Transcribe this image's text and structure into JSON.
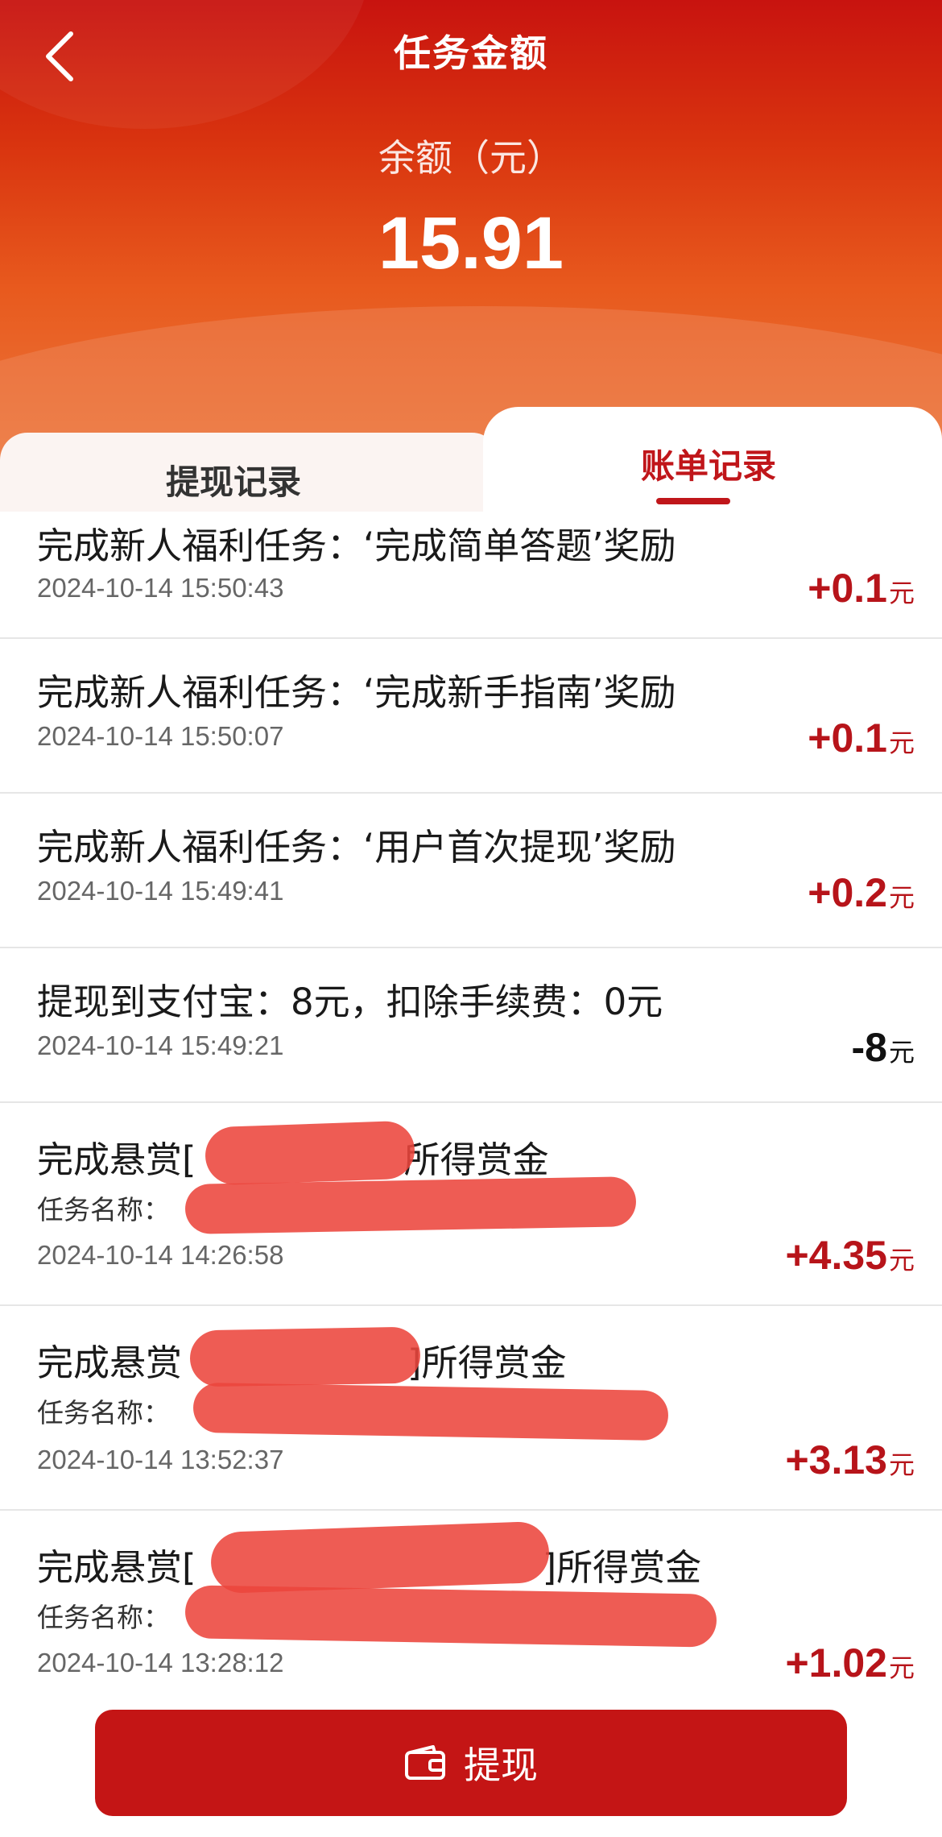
{
  "header": {
    "title": "任务金额",
    "balance_label": "余额（元）",
    "balance_value": "15.91",
    "colors": {
      "primary": "#c41515",
      "accent_text": "#c0161a"
    }
  },
  "tabs": [
    {
      "label": "提现记录",
      "active": false
    },
    {
      "label": "账单记录",
      "active": true
    }
  ],
  "records": [
    {
      "title": "完成新人福利任务：‘完成简单答题’奖励",
      "time": "2024-10-14 15:50:43",
      "amount": "+0.1",
      "unit": "元",
      "color": "#b7141a"
    },
    {
      "title": "完成新人福利任务：‘完成新手指南’奖励",
      "time": "2024-10-14 15:50:07",
      "amount": "+0.1",
      "unit": "元",
      "color": "#b7141a"
    },
    {
      "title": "完成新人福利任务：‘用户首次提现’奖励",
      "time": "2024-10-14 15:49:41",
      "amount": "+0.2",
      "unit": "元",
      "color": "#b7141a"
    },
    {
      "title": "提现到支付宝：8元，扣除手续费：0元",
      "time": "2024-10-14 15:49:21",
      "amount": "-8",
      "unit": "元",
      "color": "#111111"
    },
    {
      "title_prefix": "完成悬赏[",
      "title_suffix": "所得赏金",
      "sub": "任务名称：",
      "time": "2024-10-14 14:26:58",
      "amount": "+4.35",
      "unit": "元",
      "color": "#b7141a"
    },
    {
      "title_prefix": "完成悬赏",
      "title_suffix": "]所得赏金",
      "sub": "任务名称：",
      "time": "2024-10-14 13:52:37",
      "amount": "+3.13",
      "unit": "元",
      "color": "#b7141a"
    },
    {
      "title_prefix": "完成悬赏[",
      "title_suffix": "]所得赏金",
      "sub": "任务名称：",
      "time": "2024-10-14 13:28:12",
      "amount": "+1.02",
      "unit": "元",
      "color": "#b7141a"
    }
  ],
  "withdraw_button": {
    "label": "提现",
    "icon": "wallet-icon"
  },
  "icons": {
    "back": "back-chevron-icon",
    "wallet": "wallet-icon"
  }
}
